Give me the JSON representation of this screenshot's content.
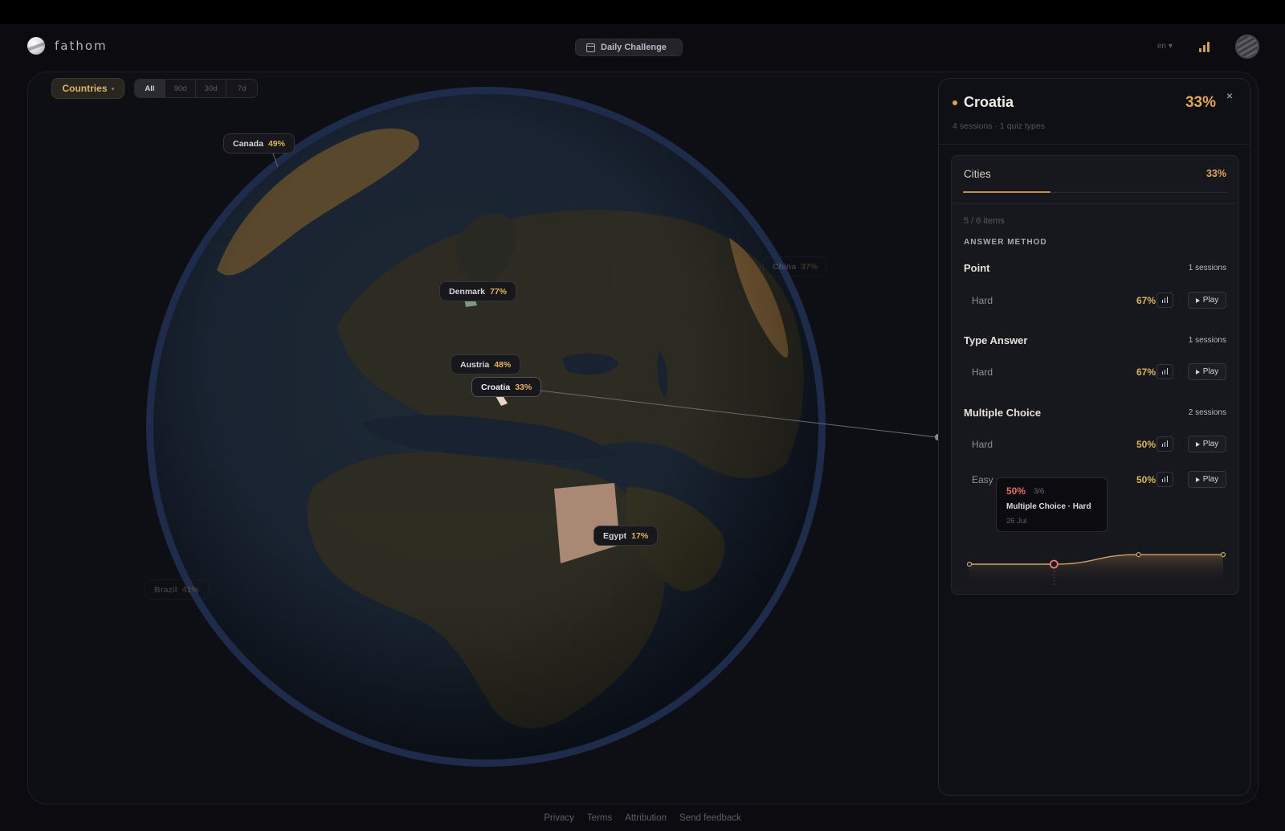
{
  "app": {
    "name": "fathom"
  },
  "header": {
    "daily_challenge": "Daily Challenge",
    "language": "en ▾"
  },
  "controls": {
    "dataset_label": "Countries",
    "ranges": [
      "All",
      "90d",
      "30d",
      "7d"
    ],
    "active_range": "All"
  },
  "globe": {
    "tags": [
      {
        "country": "Canada",
        "pct": "49%",
        "state": "normal"
      },
      {
        "country": "Denmark",
        "pct": "77%",
        "state": "normal"
      },
      {
        "country": "Austria",
        "pct": "48%",
        "state": "normal"
      },
      {
        "country": "Croatia",
        "pct": "33%",
        "state": "selected"
      },
      {
        "country": "Egypt",
        "pct": "17%",
        "state": "normal"
      },
      {
        "country": "China",
        "pct": "37%",
        "state": "faded"
      },
      {
        "country": "Brazil",
        "pct": "41%",
        "state": "faded"
      }
    ]
  },
  "panel": {
    "country": "Croatia",
    "pct": "33%",
    "meta": "4 sessions · 1 quiz types",
    "close": "×",
    "quiz": {
      "name": "Cities",
      "pct": "33%",
      "progress": 0.33,
      "items": "5 / 6 items",
      "answer_method_label": "ANSWER METHOD",
      "methods": [
        {
          "name": "Point",
          "sessions": "1 sessions",
          "difficulties": [
            {
              "level": "Hard",
              "pct": "67%",
              "play": "Play"
            }
          ]
        },
        {
          "name": "Type Answer",
          "sessions": "1 sessions",
          "difficulties": [
            {
              "level": "Hard",
              "pct": "67%",
              "play": "Play"
            }
          ]
        },
        {
          "name": "Multiple Choice",
          "sessions": "2 sessions",
          "difficulties": [
            {
              "level": "Hard",
              "pct": "50%",
              "play": "Play"
            },
            {
              "level": "Easy",
              "pct": "50%",
              "play": "Play"
            }
          ]
        }
      ],
      "tooltip": {
        "pct": "50%",
        "fraction": "3/6",
        "label": "Multiple Choice · Hard",
        "date": "26 Jul"
      },
      "trend": {
        "values": [
          50,
          50,
          67,
          67
        ],
        "highlight_index": 1
      }
    }
  },
  "footer": {
    "links": [
      "Privacy",
      "Terms",
      "Attribution",
      "Send feedback"
    ]
  },
  "colors": {
    "accent": "#e0a34b",
    "background": "#0b0b10",
    "panel": "#0f0f16",
    "tooltip_pct": "#e86a6a"
  }
}
